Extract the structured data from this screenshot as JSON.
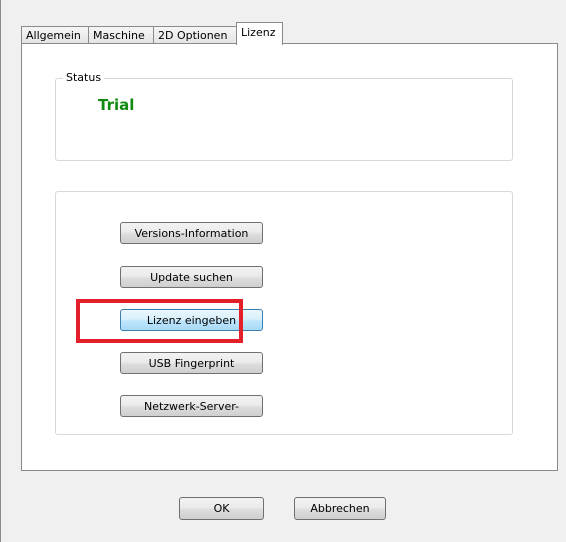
{
  "tabs": [
    {
      "label": "Allgemein",
      "active": false
    },
    {
      "label": "Maschine",
      "active": false
    },
    {
      "label": "2D Optionen",
      "active": false
    },
    {
      "label": "Lizenz",
      "active": true
    }
  ],
  "status_group": {
    "legend": "Status",
    "value": "Trial",
    "value_color": "#118a11"
  },
  "actions": [
    {
      "label": "Versions-Information"
    },
    {
      "label": "Update suchen"
    },
    {
      "label": "Lizenz eingeben",
      "highlighted": true
    },
    {
      "label": "USB Fingerprint"
    },
    {
      "label": "Netzwerk-Server-"
    }
  ],
  "dialog_buttons": {
    "ok": "OK",
    "cancel": "Abbrechen"
  },
  "colors": {
    "highlight": "#e32029",
    "status_text": "#118a11"
  }
}
